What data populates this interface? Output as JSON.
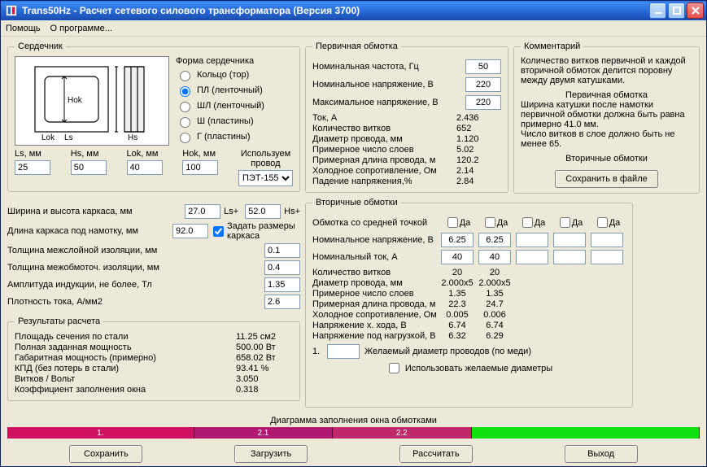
{
  "window": {
    "title": "Trans50Hz - Расчет сетевого силового трансформатора (Версия 3700)"
  },
  "menu": {
    "help": "Помощь",
    "about": "О программе..."
  },
  "core": {
    "legend": "Сердечник",
    "form_label": "Форма сердечника",
    "radios": {
      "ring": "Кольцо (тор)",
      "pl": "ПЛ (ленточный)",
      "shl": "ШЛ (ленточный)",
      "sh": "Ш (пластины)",
      "g": "Г (пластины)"
    },
    "dims": {
      "ls_label": "Ls, мм",
      "ls": "25",
      "hs_label": "Hs, мм",
      "hs": "50",
      "lok_label": "Lok, мм",
      "lok": "40",
      "hok_label": "Hok, мм",
      "hok": "100"
    },
    "wire_label": "Используем провод",
    "wire_value": "ПЭТ-155"
  },
  "params": {
    "frame_wh": "Ширина и высота каркаса, мм",
    "frame_w": "27.0",
    "frame_h": "52.0",
    "lsplus": "Ls+",
    "hsplus": "Hs+",
    "frame_len": "Длина каркаса под намотку, мм",
    "frame_len_v": "92.0",
    "set_frame": "Задать размеры каркаса",
    "interlayer": "Толщина межслойной изоляции, мм",
    "interlayer_v": "0.1",
    "intercoil": "Толщина межобмоточ. изоляции, мм",
    "intercoil_v": "0.4",
    "induction": "Амплитуда индукции, не более, Тл",
    "induction_v": "1.35",
    "density": "Плотность тока, А/мм2",
    "density_v": "2.6"
  },
  "results": {
    "legend": "Результаты расчета",
    "rows": [
      {
        "l": "Площадь сечения по стали",
        "v": "11.25 см2"
      },
      {
        "l": "Полная заданная мощность",
        "v": "500.00 Вт"
      },
      {
        "l": "Габаритная мощность (примерно)",
        "v": "658.02 Вт"
      },
      {
        "l": "КПД (без потерь в стали)",
        "v": "93.41 %"
      },
      {
        "l": "Витков / Вольт",
        "v": "3.050"
      },
      {
        "l": "Коэффициент заполнения окна",
        "v": "0.318"
      }
    ]
  },
  "primary": {
    "legend": "Первичная обмотка",
    "freq_l": "Номинальная частота, Гц",
    "freq": "50",
    "vnom_l": "Номинальное напряжение, В",
    "vnom": "220",
    "vmax_l": "Максимальное напряжение, В",
    "vmax": "220",
    "rows": [
      {
        "l": "Ток, А",
        "v": "2.436"
      },
      {
        "l": "Количество витков",
        "v": "652"
      },
      {
        "l": "Диаметр провода, мм",
        "v": "1.120"
      },
      {
        "l": "Примерное число слоев",
        "v": "5.02"
      },
      {
        "l": "Примерная длина провода, м",
        "v": "120.2"
      },
      {
        "l": "Холодное сопротивление, Ом",
        "v": "2.14"
      },
      {
        "l": "Падение напряжения,%",
        "v": "2.84"
      }
    ]
  },
  "secondary": {
    "legend": "Вторичные обмотки",
    "ct_label": "Обмотка со средней точкой",
    "da": "Да",
    "vnom_l": "Номинальное напряжение, В",
    "inom_l": "Номинальный ток, А",
    "col": [
      {
        "v": "6.25",
        "i": "40",
        "ct": false
      },
      {
        "v": "6.25",
        "i": "40",
        "ct": false
      },
      {
        "v": "",
        "i": "",
        "ct": false
      },
      {
        "v": "",
        "i": "",
        "ct": false
      },
      {
        "v": "",
        "i": "",
        "ct": false
      }
    ],
    "rows": [
      {
        "l": "Количество витков",
        "c": [
          "20",
          "20",
          "",
          "",
          ""
        ]
      },
      {
        "l": "Диаметр провода, мм",
        "c": [
          "2.000x5",
          "2.000x5",
          "",
          "",
          ""
        ]
      },
      {
        "l": "Примерное число слоев",
        "c": [
          "1.35",
          "1.35",
          "",
          "",
          ""
        ]
      },
      {
        "l": "Примерная длина провода, м",
        "c": [
          "22.3",
          "24.7",
          "",
          "",
          ""
        ]
      },
      {
        "l": "Холодное сопротивление, Ом",
        "c": [
          "0.005",
          "0.006",
          "",
          "",
          ""
        ]
      },
      {
        "l": "Напряжение х. хода, В",
        "c": [
          "6.74",
          "6.74",
          "",
          "",
          ""
        ]
      },
      {
        "l": "Напряжение под нагрузкой, В",
        "c": [
          "6.32",
          "6.29",
          "",
          "",
          ""
        ]
      }
    ],
    "wish_n": "1.",
    "wish_label": "Желаемый диаметр проводов (по меди)",
    "use_wish": "Использовать желаемые диаметры"
  },
  "comment": {
    "legend": "Комментарий",
    "l1": "Количество витков первичной и каждой вторичной обмоток делится поровну между двумя катушками.",
    "h2": "Первичная обмотка",
    "l2": "Ширина катушки после намотки первичной обмотки должна быть равна примерно 41.0 мм.",
    "l3": "Число витков в слое должно быть не менее 65.",
    "h3": "Вторичные обмотки",
    "save": "Сохранить в файле"
  },
  "diagram": {
    "legend": "Диаграмма заполнения окна обмотками",
    "labels": [
      "1.",
      "2.1",
      "2.2",
      ""
    ]
  },
  "buttons": {
    "save": "Сохранить",
    "load": "Загрузить",
    "calc": "Рассчитать",
    "exit": "Выход"
  }
}
